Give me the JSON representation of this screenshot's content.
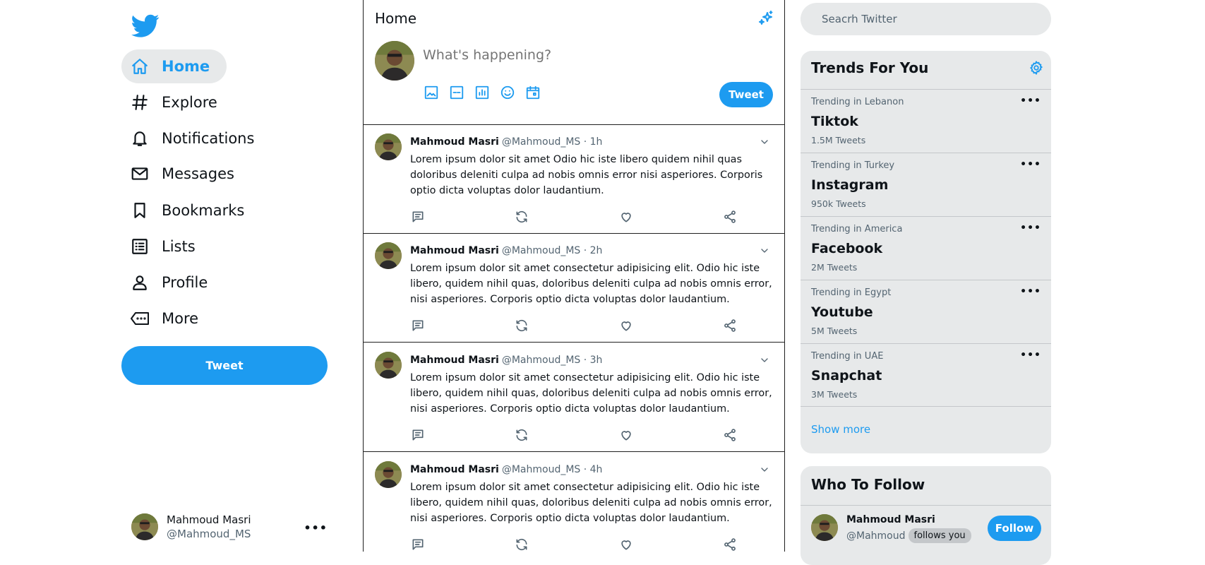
{
  "theme": {
    "accent": "#1d9bf0",
    "panel": "#e7e9ea",
    "text": "#0f1419",
    "muted": "#536471"
  },
  "nav": {
    "logo_icon": "twitter-bird-icon",
    "items": [
      {
        "label": "Home",
        "icon": "home-icon",
        "active": true
      },
      {
        "label": "Explore",
        "icon": "hashtag-icon"
      },
      {
        "label": "Notifications",
        "icon": "bell-icon"
      },
      {
        "label": "Messages",
        "icon": "envelope-icon"
      },
      {
        "label": "Bookmarks",
        "icon": "bookmark-icon"
      },
      {
        "label": "Lists",
        "icon": "list-icon"
      },
      {
        "label": "Profile",
        "icon": "person-icon"
      },
      {
        "label": "More",
        "icon": "more-icon"
      }
    ],
    "tweet_button": "Tweet",
    "account": {
      "name": "Mahmoud Masri",
      "handle": "@Mahmoud_MS",
      "menu": "•••"
    }
  },
  "feed": {
    "title": "Home",
    "compose": {
      "placeholder": "What's happening?",
      "button": "Tweet"
    },
    "tweets": [
      {
        "name": "Mahmoud Masri",
        "meta": "@Mahmoud_MS · 1h",
        "text": "Lorem ipsum dolor sit amet Odio hic iste libero quidem nihil quas doloribus deleniti culpa ad nobis omnis error nisi asperiores. Corporis optio dicta voluptas dolor laudantium."
      },
      {
        "name": "Mahmoud Masri",
        "meta": "@Mahmoud_MS · 2h",
        "text": "Lorem ipsum dolor sit amet consectetur adipisicing elit. Odio hic iste libero, quidem nihil quas, doloribus deleniti culpa ad nobis omnis error, nisi asperiores. Corporis optio dicta voluptas dolor laudantium."
      },
      {
        "name": "Mahmoud Masri",
        "meta": "@Mahmoud_MS · 3h",
        "text": "Lorem ipsum dolor sit amet consectetur adipisicing elit. Odio hic iste libero, quidem nihil quas, doloribus deleniti culpa ad nobis omnis error, nisi asperiores. Corporis optio dicta voluptas dolor laudantium."
      },
      {
        "name": "Mahmoud Masri",
        "meta": "@Mahmoud_MS · 4h",
        "text": "Lorem ipsum dolor sit amet consectetur adipisicing elit. Odio hic iste libero, quidem nihil quas, doloribus deleniti culpa ad nobis omnis error, nisi asperiores. Corporis optio dicta voluptas dolor laudantium."
      }
    ]
  },
  "sidebar": {
    "search_placeholder": "Seacrh Twitter",
    "trends_title": "Trends For You",
    "trends": [
      {
        "context": "Trending in Lebanon",
        "topic": "Tiktok",
        "count": "1.5M Tweets"
      },
      {
        "context": "Trending in Turkey",
        "topic": "Instagram",
        "count": "950k Tweets"
      },
      {
        "context": "Trending in America",
        "topic": "Facebook",
        "count": "2M Tweets"
      },
      {
        "context": "Trending in Egypt",
        "topic": "Youtube",
        "count": "5M Tweets"
      },
      {
        "context": "Trending in UAE",
        "topic": "Snapchat",
        "count": "3M Tweets"
      }
    ],
    "trend_menu": "•••",
    "show_more": "Show more",
    "who_to_follow_title": "Who To Follow",
    "follow": {
      "name": "Mahmoud Masri",
      "handle": "@Mahmoud",
      "badge": "follows you",
      "button": "Follow"
    }
  }
}
